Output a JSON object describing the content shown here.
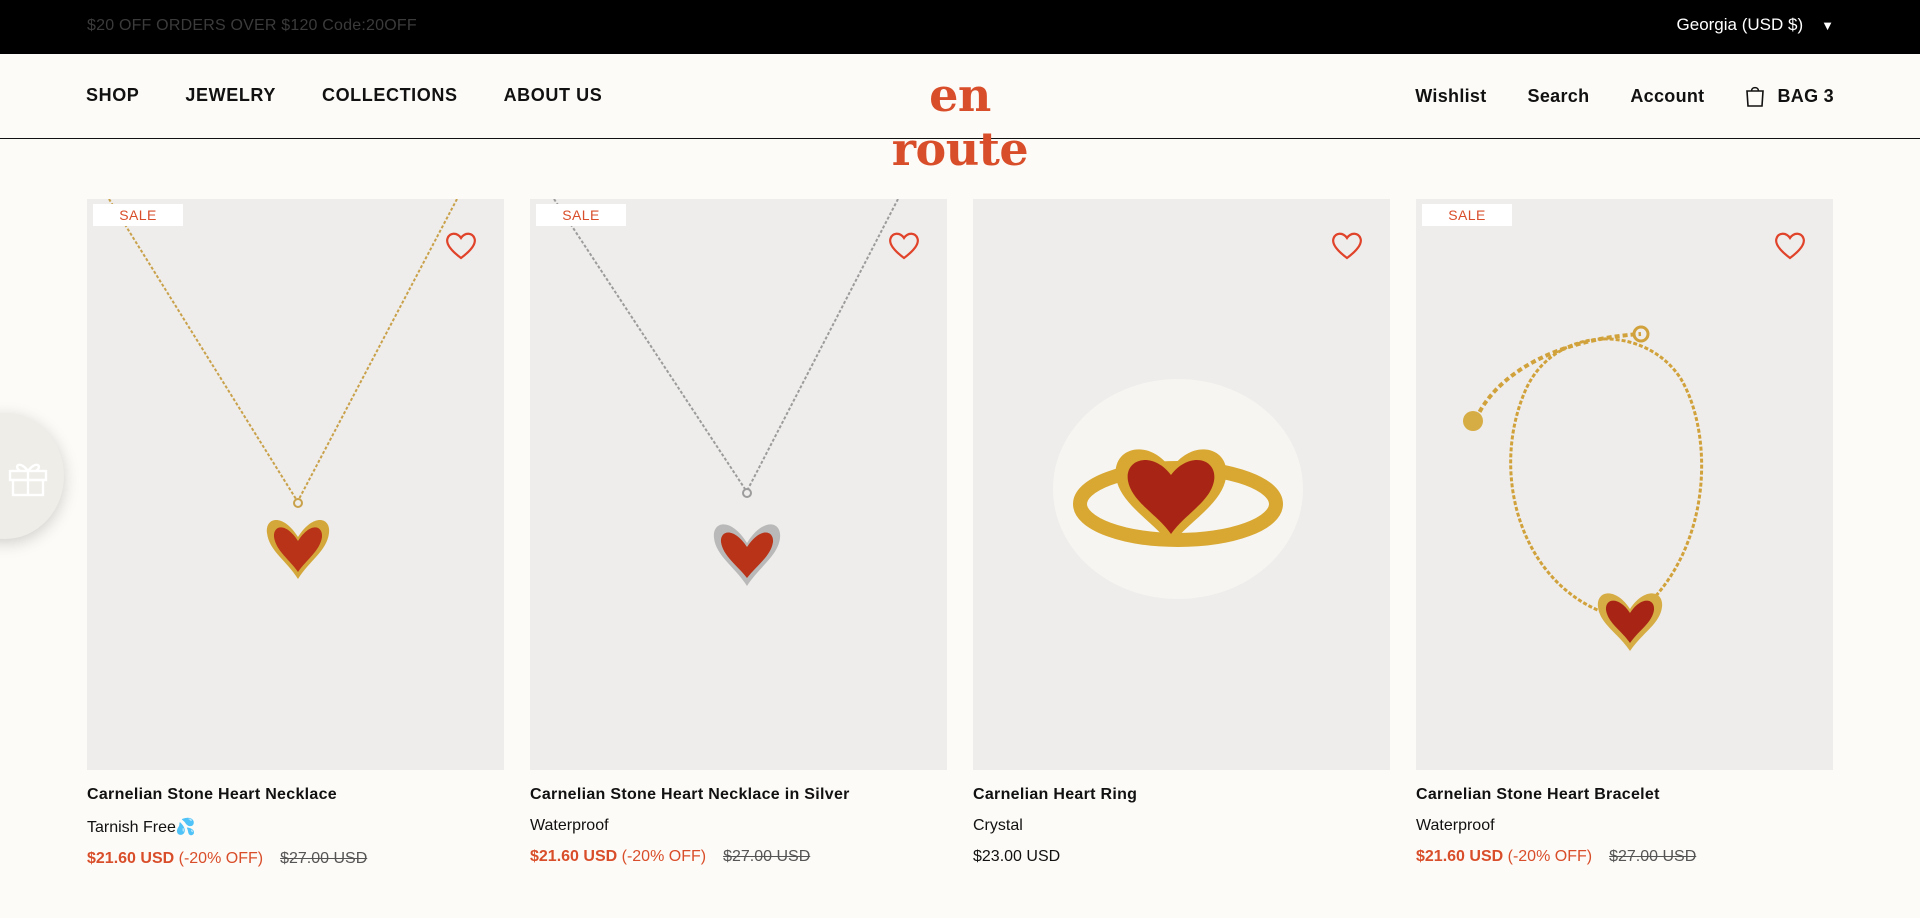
{
  "announcement": "$20 OFF ORDERS OVER $120 Code:20OFF",
  "region": {
    "label": "Georgia (USD $)",
    "caret": "▼"
  },
  "nav": {
    "shop": "SHOP",
    "jewelry": "JEWELRY",
    "collections": "COLLECTIONS",
    "about": "ABOUT US"
  },
  "logo": "en route",
  "account_nav": {
    "wishlist": "Wishlist",
    "search": "Search",
    "account": "Account",
    "bag": "BAG 3"
  },
  "products": [
    {
      "badge": "SALE",
      "title": "Carnelian Stone Heart Necklace",
      "subtitle": "Tarnish Free💦",
      "price": "$21.60 USD",
      "discount": "(-20% OFF)",
      "old_price": "$27.00 USD"
    },
    {
      "badge": "SALE",
      "title": "Carnelian Stone Heart Necklace in Silver",
      "subtitle": "Waterproof",
      "price": "$21.60 USD",
      "discount": "(-20% OFF)",
      "old_price": "$27.00 USD"
    },
    {
      "title": "Carnelian Heart Ring",
      "subtitle": "Crystal",
      "price": "$23.00 USD"
    },
    {
      "badge": "SALE",
      "title": "Carnelian Stone Heart Bracelet",
      "subtitle": "Waterproof",
      "price": "$21.60 USD",
      "discount": "(-20% OFF)",
      "old_price": "$27.00 USD"
    }
  ],
  "icons": {
    "wishlist_button": "heart-outline-icon",
    "bag": "shopping-bag-icon",
    "rewards": "gift-icon"
  },
  "colors": {
    "accent": "#d94e2a",
    "announcement_bg": "#000000",
    "page_bg": "#fdfbf7",
    "card_bg": "#eeedeb"
  }
}
